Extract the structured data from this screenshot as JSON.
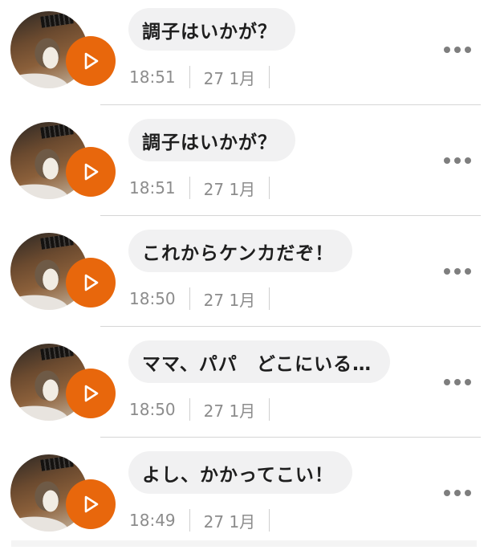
{
  "messages": [
    {
      "text": "調子はいかが？",
      "time": "18:51",
      "date": "27 1月"
    },
    {
      "text": "調子はいかが？",
      "time": "18:51",
      "date": "27 1月"
    },
    {
      "text": "これからケンカだぞ！",
      "time": "18:50",
      "date": "27 1月"
    },
    {
      "text": "ママ、パパ　どこにいる…",
      "time": "18:50",
      "date": "27 1月"
    },
    {
      "text": "よし、かかってこい！",
      "time": "18:49",
      "date": "27 1月"
    }
  ],
  "colors": {
    "accent": "#e8670c",
    "bubble": "#f1f1f2",
    "meta": "#8c8c8c"
  },
  "icons": {
    "play": "play-icon",
    "more": "more-dots-icon",
    "avatar": "cat-avatar"
  }
}
